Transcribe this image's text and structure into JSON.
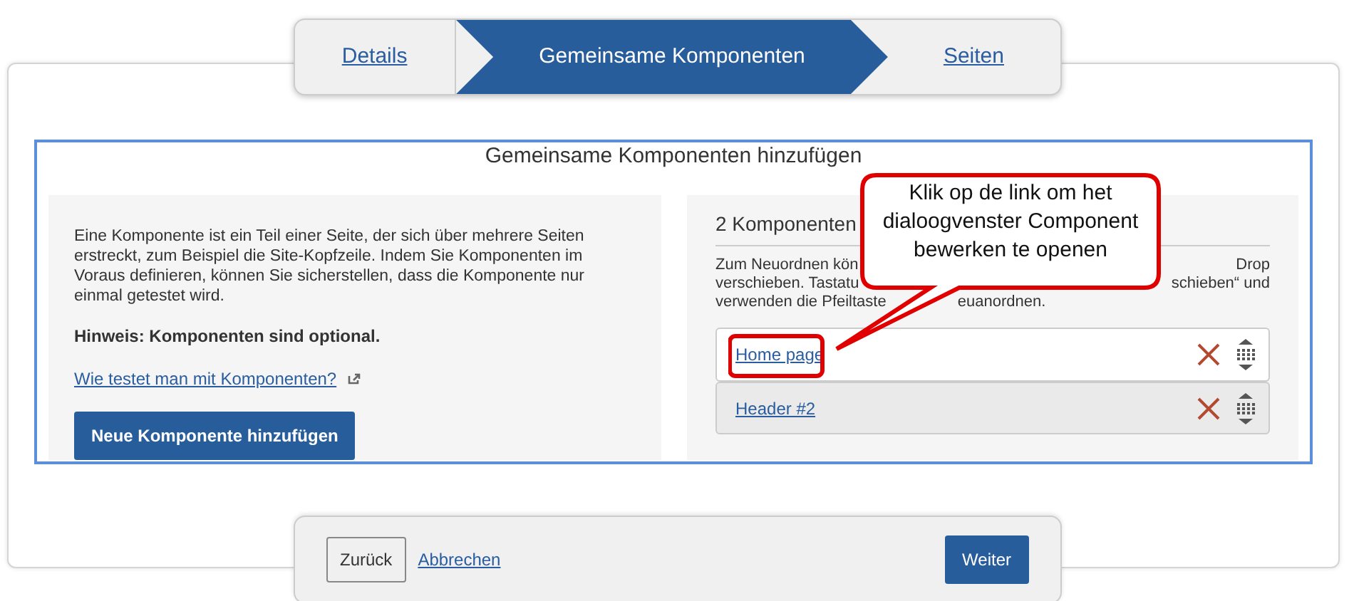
{
  "steps": [
    {
      "label": "Details",
      "selected": false
    },
    {
      "label": "Gemeinsame Komponenten",
      "selected": true
    },
    {
      "label": "Seiten",
      "selected": false
    }
  ],
  "panel": {
    "title": "Gemeinsame Komponenten hinzufügen"
  },
  "intro": {
    "text": "Eine Komponente ist ein Teil einer Seite, der sich über mehrere Seiten erstreckt, zum Beispiel die Site-Kopfzeile. Indem Sie Komponenten im Voraus definieren, können Sie sicherstellen, dass die Komponente nur einmal getestet wird.",
    "note": "Hinweis: Komponenten sind optional.",
    "help_link": "Wie testet man mit Komponenten?",
    "add_button": "Neue Komponente hinzufügen"
  },
  "components": {
    "heading": "2 Komponenten",
    "instructions": [
      {
        "kind": "split",
        "left": "Zum Neuordnen kön",
        "right": "Drop"
      },
      {
        "kind": "split",
        "left": "verschieben. Tastatu",
        "right": "schieben“ und"
      },
      {
        "kind": "run",
        "left": "verwenden die Pfeiltaste",
        "right": "euanordnen."
      }
    ],
    "items": [
      {
        "label": "Home page",
        "selected": false
      },
      {
        "label": "Header #2",
        "selected": true
      }
    ]
  },
  "callout": {
    "text": "Klik op de link om het dialoogvenster Component bewerken te openen"
  },
  "footer": {
    "back": "Zurück",
    "cancel": "Abbrechen",
    "next": "Weiter"
  }
}
